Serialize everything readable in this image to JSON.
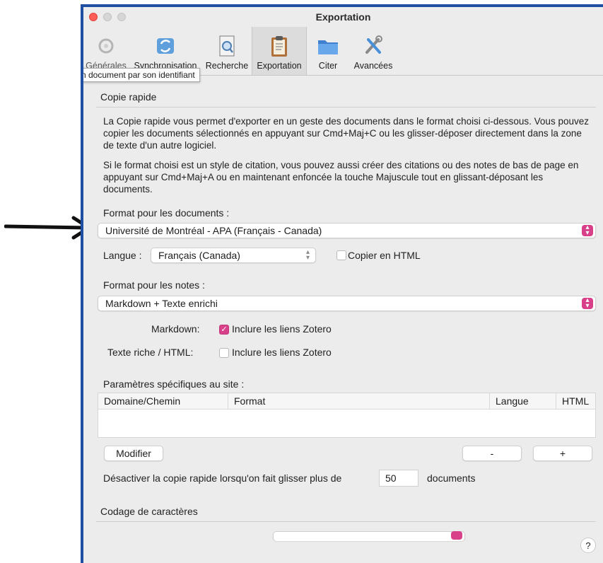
{
  "window": {
    "title": "Exportation"
  },
  "toolbar": {
    "tooltip": "n document par son identifiant",
    "items": [
      {
        "label": "Générales",
        "icon": "gear-icon"
      },
      {
        "label": "Synchronisation",
        "icon": "sync-icon"
      },
      {
        "label": "Recherche",
        "icon": "search-doc-icon"
      },
      {
        "label": "Exportation",
        "icon": "clipboard-icon"
      },
      {
        "label": "Citer",
        "icon": "folder-icon"
      },
      {
        "label": "Avancées",
        "icon": "tools-icon"
      }
    ]
  },
  "quick_copy": {
    "title": "Copie rapide",
    "para1": "La Copie rapide vous permet d'exporter en un geste des documents dans le format choisi ci-dessous. Vous pouvez copier les documents sélectionnés en appuyant sur Cmd+Maj+C ou les glisser-déposer directement dans la zone de texte d'un autre logiciel.",
    "para2": "Si le format choisi est un style de citation, vous pouvez aussi créer des citations ou des notes de bas de page en appuyant sur Cmd+Maj+A ou en maintenant enfoncée la touche Majuscule tout en glissant-déposant les documents.",
    "doc_format_label": "Format pour les documents :",
    "doc_format_value": "Université de Montréal - APA (Français - Canada)",
    "language_label": "Langue :",
    "language_value": "Français (Canada)",
    "copy_html_label": "Copier en HTML",
    "notes_format_label": "Format pour les notes :",
    "notes_format_value": "Markdown + Texte enrichi",
    "markdown_label": "Markdown:",
    "markdown_links_label": "Inclure les liens Zotero",
    "markdown_links_checked": true,
    "richtext_label": "Texte riche / HTML:",
    "richtext_links_label": "Inclure les liens Zotero",
    "richtext_links_checked": false,
    "site_params_label": "Paramètres spécifiques au site :",
    "table_headers": [
      "Domaine/Chemin",
      "Format",
      "Langue",
      "HTML"
    ],
    "edit_button": "Modifier",
    "minus_button": "-",
    "plus_button": "+",
    "disable_label": "Désactiver la copie rapide lorsqu'on fait glisser plus de",
    "disable_count": "50",
    "disable_suffix": "documents"
  },
  "encoding": {
    "title": "Codage de caractères"
  },
  "help_button": "?",
  "colors": {
    "accent": "#d8408a",
    "window_border": "#1f4fa3"
  }
}
